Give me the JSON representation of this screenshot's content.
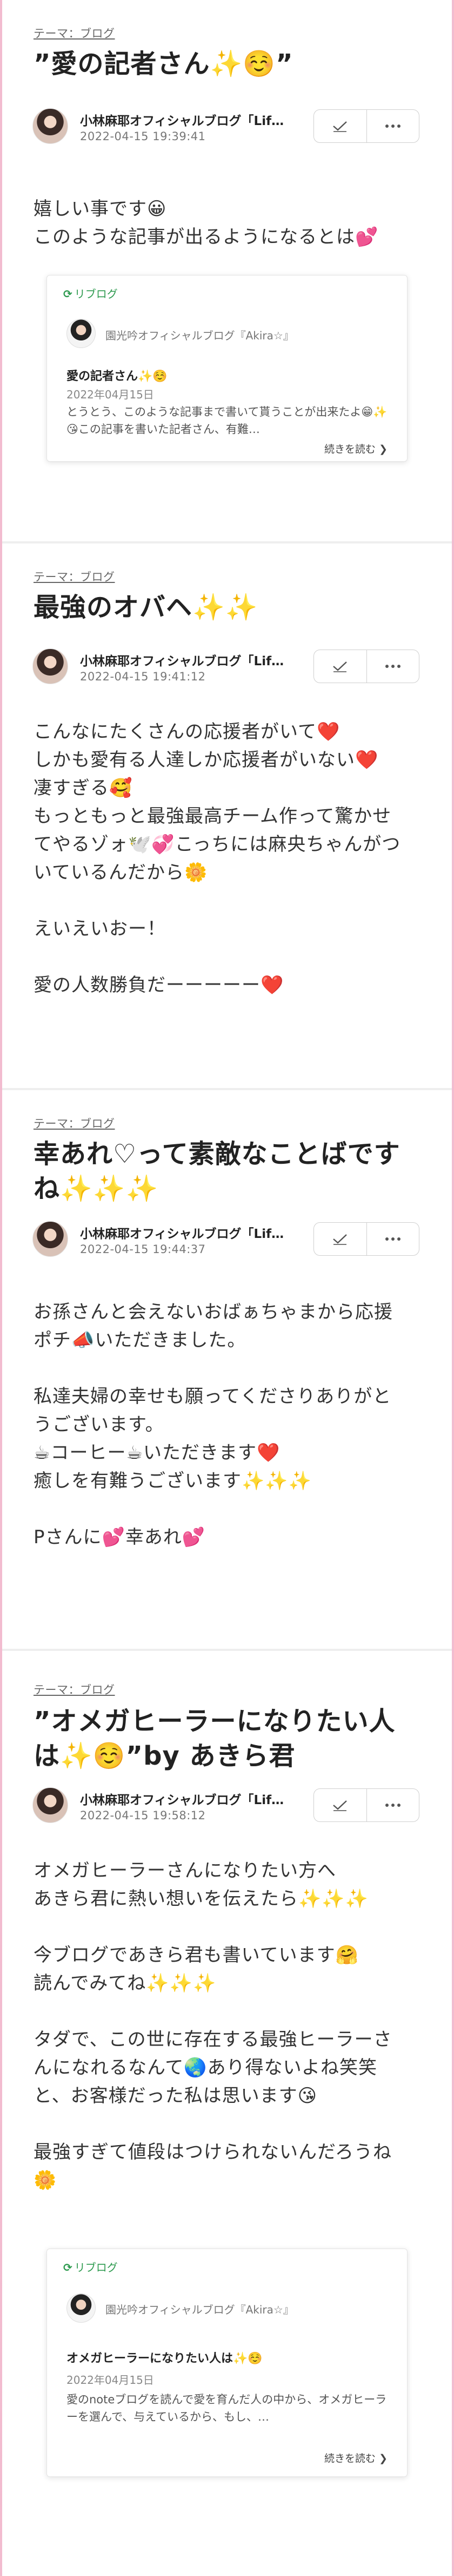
{
  "posts": [
    {
      "theme_tag": "テーマ：ブログ",
      "reblog_icon": "⟳",
      "title": "”愛の記者さん✨☺️”",
      "author": "小林麻耶オフィシャルブログ「Lif…",
      "date": "2022-04-15 19:39:41",
      "body": "嬉しい事です😀\nこのような記事が出るようになるとは💕",
      "reblog": {
        "label": "リブログ",
        "blog_name": "園光吟オフィシャルブログ『Akira☆』",
        "title": "愛の記者さん✨☺️",
        "date": "2022年04月15日",
        "excerpt": "とうとう、このような記事まで書いて貰うことが出来たよ😁✨😘この記事を書いた記者さん、有難…",
        "read_more": "続きを読む ❯"
      }
    },
    {
      "theme_tag": "テーマ：ブログ",
      "title": "最強のオバヘ✨✨",
      "author": "小林麻耶オフィシャルブログ「Lif…",
      "date": "2022-04-15 19:41:12",
      "body": "こんなにたくさんの応援者がいて❤️\nしかも愛有る人達しか応援者がいない❤️\n凄すぎる🥰\nもっともっと最強最高チーム作って驚かせ\nてやるゾォ🕊️💞こっちには麻央ちゃんがつ\nいているんだから🌼\n\nえいえいおー！\n\n愛の人数勝負だーーーーー❤️"
    },
    {
      "theme_tag": "テーマ：ブログ",
      "title": "幸あれ♡って素敵なことばです\nね✨✨✨",
      "author": "小林麻耶オフィシャルブログ「Lif…",
      "date": "2022-04-15 19:44:37",
      "body": "お孫さんと会えないおばぁちゃまから応援\nポチ📣いただきました。\n\n私達夫婦の幸せも願ってくださりありがと\nうございます。\n☕コーヒー☕いただきます❤️\n癒しを有難うございます✨✨✨\n\nPさんに💕幸あれ💕"
    },
    {
      "theme_tag": "テーマ：ブログ",
      "reblog_icon": "⟳",
      "title": "”オメガヒーラーになりたい人\nは✨☺️”by あきら君",
      "author": "小林麻耶オフィシャルブログ「Lif…",
      "date": "2022-04-15 19:58:12",
      "body": "オメガヒーラーさんになりたい方へ\nあきら君に熱い想いを伝えたら✨✨✨\n\n今ブログであきら君も書いています🤗\n読んでみてね✨✨✨\n\nタダで、この世に存在する最強ヒーラーさ\nんになれるなんて🌏あり得ないよね笑笑\nと、お客様だった私は思います😘\n\n最強すぎて値段はつけられないんだろうね\n🌼",
      "reblog": {
        "label": "リブログ",
        "blog_name": "園光吟オフィシャルブログ『Akira☆』",
        "title": "オメガヒーラーになりたい人は✨☺️",
        "date": "2022年04月15日",
        "excerpt": "愛のnoteブログを読んで愛を育んだ人の中から、オメガヒーラーを選んで、与えているから、もし、…",
        "read_more": "続きを読む ❯"
      }
    }
  ]
}
